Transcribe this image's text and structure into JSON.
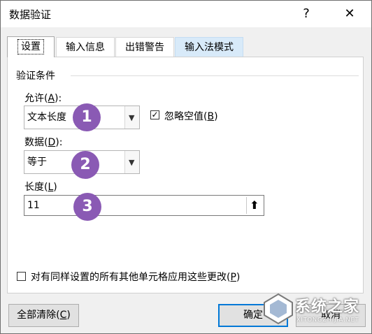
{
  "window": {
    "title": "数据验证",
    "help_glyph": "?",
    "close_glyph": "✕"
  },
  "tabs": [
    {
      "label": "设置",
      "selected": true
    },
    {
      "label": "输入信息",
      "selected": false
    },
    {
      "label": "出错警告",
      "selected": false
    },
    {
      "label": "输入法模式",
      "selected": false
    }
  ],
  "validation": {
    "group_label": "验证条件",
    "allow": {
      "prefix": "允许(",
      "key": "A",
      "suffix": "):",
      "value": "文本长度"
    },
    "ignore_blank": {
      "prefix": "忽略空值(",
      "key": "B",
      "suffix": ")",
      "checked": true
    },
    "data": {
      "prefix": "数据(",
      "key": "D",
      "suffix": "):",
      "value": "等于"
    },
    "length": {
      "prefix": "长度(",
      "key": "L",
      "suffix": ")",
      "value": "11",
      "ref_glyph": "⬆"
    }
  },
  "apply_all": {
    "prefix": "对有同样设置的所有其他单元格应用这些更改(",
    "key": "P",
    "suffix": ")",
    "checked": false
  },
  "buttons": {
    "clear_all": {
      "prefix": "全部清除(",
      "key": "C",
      "suffix": ")"
    },
    "ok": "确定",
    "cancel": "取消"
  },
  "badges": [
    "1",
    "2",
    "3"
  ],
  "watermark": {
    "text": "系统之家",
    "sub": "XITONGZHIJIA.NET"
  },
  "colors": {
    "badge": "#8a5ab4",
    "default_button_border": "#0078d7"
  }
}
